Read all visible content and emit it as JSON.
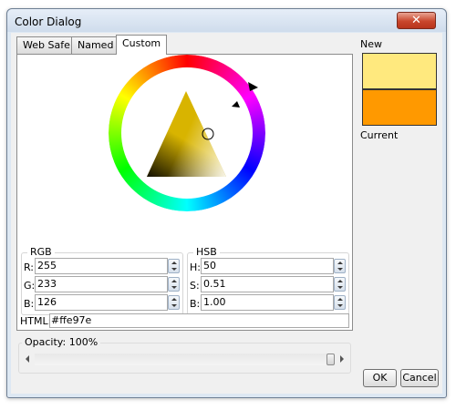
{
  "window": {
    "title": "Color Dialog",
    "close_glyph": "✕"
  },
  "tabs": [
    {
      "label": "Web Safe"
    },
    {
      "label": "Named"
    },
    {
      "label": "Custom",
      "active": true
    }
  ],
  "rgb": {
    "title": "RGB",
    "fields": [
      {
        "label": "R:",
        "value": "255"
      },
      {
        "label": "G:",
        "value": "233"
      },
      {
        "label": "B:",
        "value": "126"
      }
    ]
  },
  "hsb": {
    "title": "HSB",
    "fields": [
      {
        "label": "H:",
        "value": "50"
      },
      {
        "label": "S:",
        "value": "0.51"
      },
      {
        "label": "B:",
        "value": "1.00"
      }
    ]
  },
  "html": {
    "label": "HTML:",
    "value": "#ffe97e"
  },
  "opacity": {
    "label": "Opacity: 100%",
    "value": 1.0
  },
  "preview": {
    "new_label": "New",
    "current_label": "Current",
    "new_color": "#ffe97e",
    "current_color": "#ff9900"
  },
  "buttons": {
    "ok": "OK",
    "cancel": "Cancel"
  },
  "colors": {
    "title_bar": "#dde8f3",
    "close_button": "#c9462c"
  },
  "icons": [
    "close-icon",
    "spin-up-icon",
    "spin-down-icon",
    "scroll-left-icon",
    "scroll-right-icon"
  ]
}
